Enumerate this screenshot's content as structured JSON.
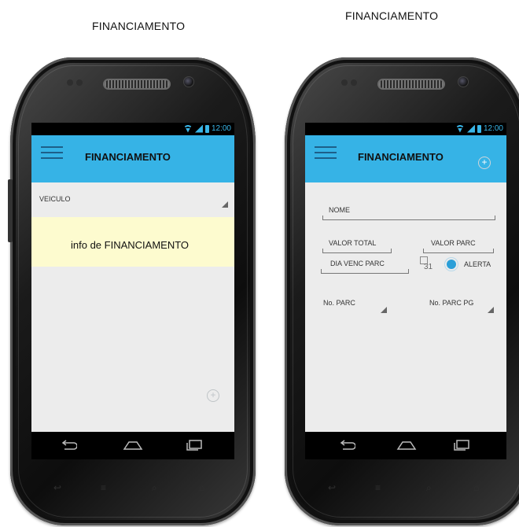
{
  "captions": {
    "left": "FINANCIAMENTO",
    "right": "FINANCIAMENTO"
  },
  "status": {
    "time": "12:00",
    "icons": [
      "wifi-icon",
      "signal-icon",
      "battery-icon"
    ]
  },
  "left_screen": {
    "title": "FINANCIAMENTO",
    "vehicle_label": "VEICULO",
    "info_text": "info de FINANCIAMENTO",
    "add_icon": "add-circle-icon"
  },
  "right_screen": {
    "title": "FINANCIAMENTO",
    "fields": {
      "nome": "NOME",
      "valor_total": "VALOR TOTAL",
      "valor_parc": "VALOR PARC",
      "dia_venc_parc": "DIA VENC PARC",
      "alerta": "ALERTA",
      "no_parc": "No. PARC",
      "no_parc_pg": "No. PARC PG"
    },
    "calendar_day": "31"
  },
  "colors": {
    "appbar": "#36b3e6",
    "info_bg": "#fdfbcf",
    "status_accent": "#39b6e8",
    "radio": "#2a9fd8"
  }
}
